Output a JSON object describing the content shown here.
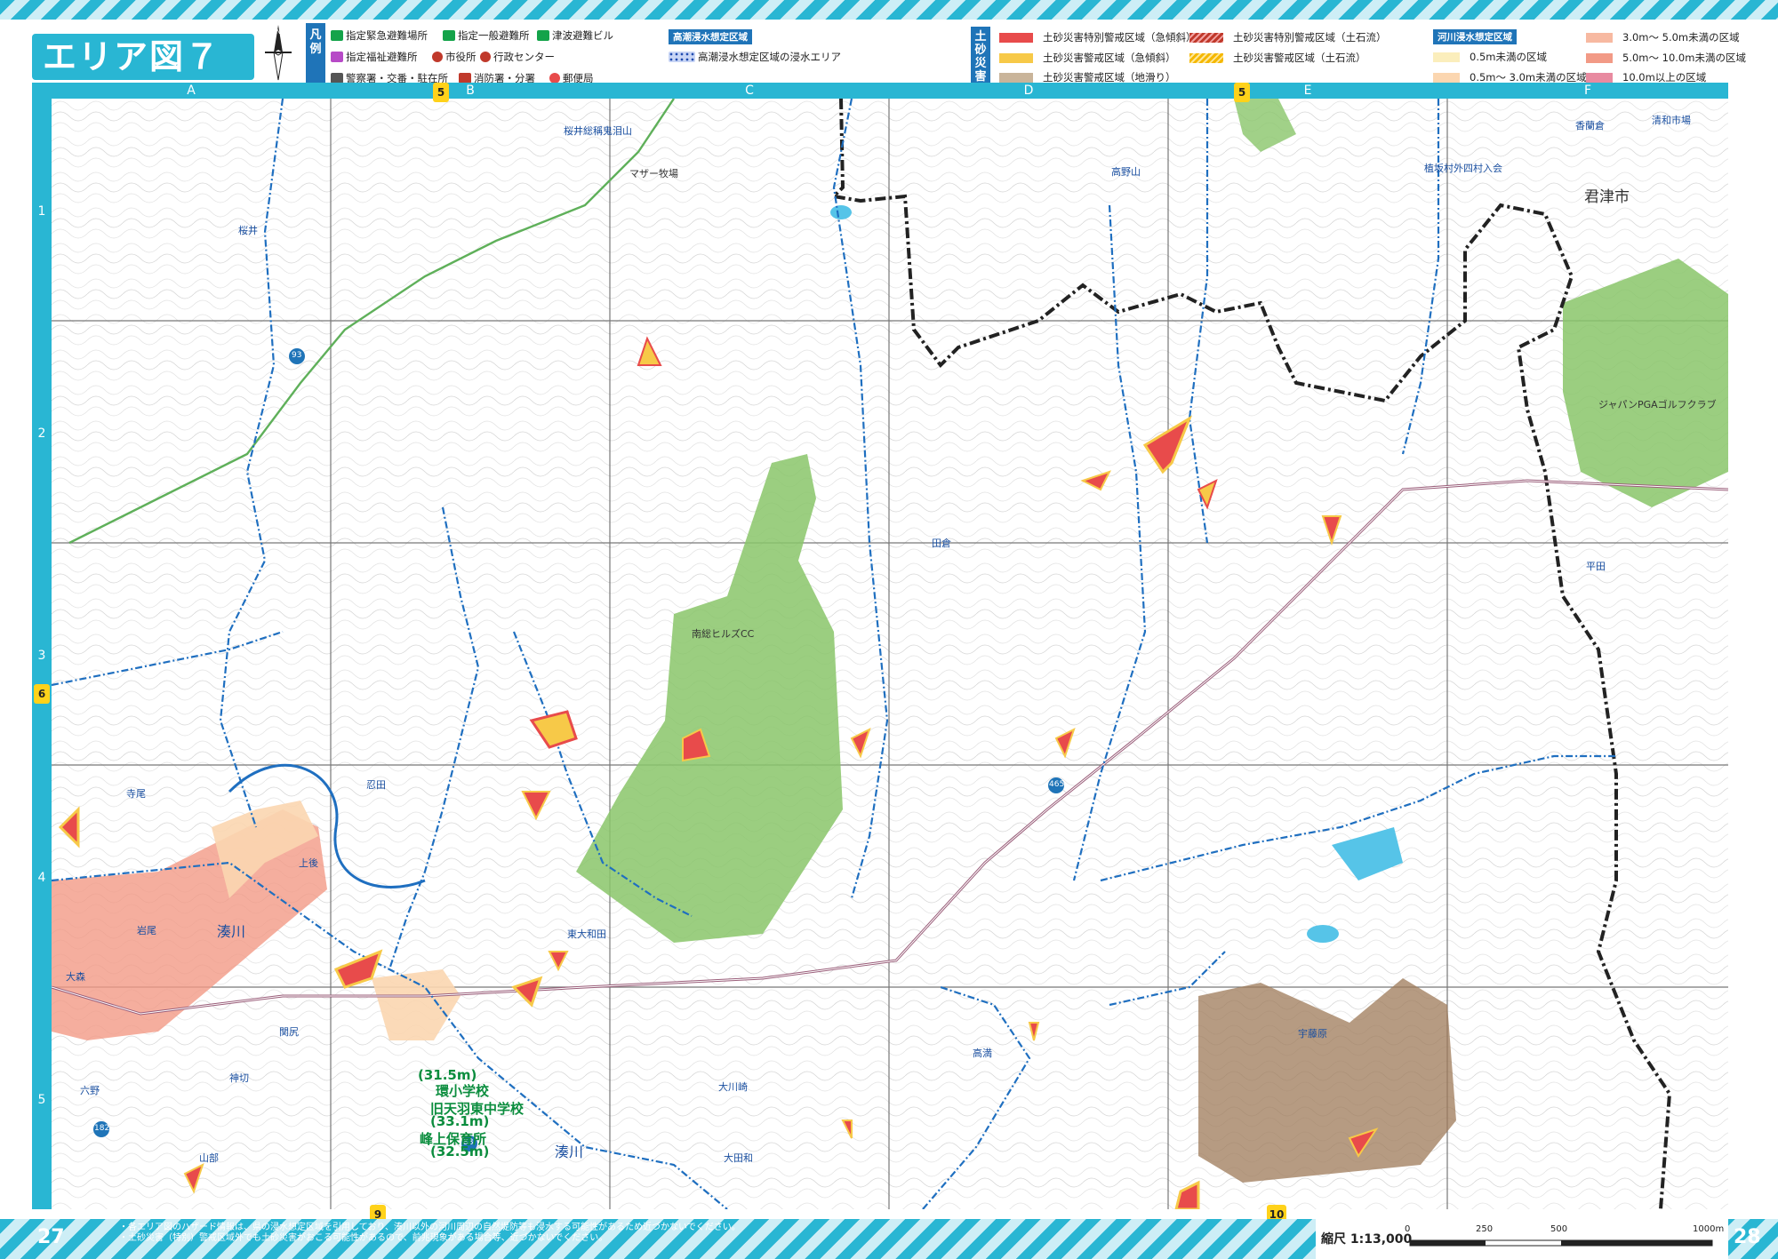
{
  "header": {
    "title": "エリア図７",
    "legend_label": "凡例",
    "legend_items": [
      {
        "label": "指定緊急避難場所",
        "icon": "emergency-shelter-icon"
      },
      {
        "label": "指定一般避難所",
        "icon": "general-shelter-icon"
      },
      {
        "label": "津波避難ビル",
        "icon": "tsunami-building-icon"
      },
      {
        "label": "指定福祉避難所",
        "icon": "welfare-shelter-icon"
      },
      {
        "label": "市役所",
        "icon": "city-hall-icon"
      },
      {
        "label": "行政センター",
        "icon": "admin-center-icon"
      },
      {
        "label": "警察署・交番・駐在所",
        "icon": "police-icon"
      },
      {
        "label": "消防署・分署",
        "icon": "fire-station-icon"
      },
      {
        "label": "郵便局",
        "icon": "post-office-icon"
      }
    ],
    "storm_surge": {
      "heading": "高潮浸水想定区域",
      "item": "高潮浸水想定区域の浸水エリア"
    },
    "sediment": {
      "heading": "土砂災害",
      "items": [
        {
          "label": "土砂災害特別警戒区域（急傾斜）",
          "color": "#e84b4b"
        },
        {
          "label": "土砂災害特別警戒区域（土石流）",
          "color": "#c0392b"
        },
        {
          "label": "土砂災害警戒区域（急傾斜）",
          "color": "#f7c948"
        },
        {
          "label": "土砂災害警戒区域（土石流）",
          "color": "#f5b800"
        },
        {
          "label": "土砂災害警戒区域（地滑り）",
          "color": "#c9b49a"
        }
      ]
    },
    "river_flood": {
      "heading": "河川浸水想定区域",
      "items": [
        {
          "label": "0.5m未満の区域",
          "color": "#fbeebc"
        },
        {
          "label": "0.5m～ 3.0m未満の区域",
          "color": "#fbd6b0"
        },
        {
          "label": "3.0m～ 5.0m未満の区域",
          "color": "#f7b9a1"
        },
        {
          "label": "5.0m～ 10.0m未満の区域",
          "color": "#f29a86"
        },
        {
          "label": "10.0m以上の区域",
          "color": "#e88aa0"
        }
      ]
    }
  },
  "grid": {
    "columns": [
      "A",
      "B",
      "C",
      "D",
      "E",
      "F"
    ],
    "rows": [
      "1",
      "2",
      "3",
      "4",
      "5"
    ]
  },
  "markers": {
    "top_b": "5",
    "top_e": "5",
    "left": "6",
    "bottom_b": "9",
    "bottom_e": "10"
  },
  "labels": {
    "sakurai_kanonji": "桜井総稱鬼泪山",
    "mother_farm": "マザー牧場",
    "takanoyama": "高野山",
    "kazusa": "君津市",
    "gengo": "香蘭倉",
    "seiwa": "清和市場",
    "nishi_shiro": "植坂村外四村入会",
    "sakurai": "桜井",
    "japan_pga": "ジャパンPGAゴルフクラブ",
    "nanso_hills": "南総ヒルズCC",
    "tagura": "田倉",
    "hirata": "平田",
    "shimoda": "忍田",
    "teramae": "寺尾",
    "ueushiro": "上後",
    "minatogawa": "湊川",
    "yoshio": "岩尾",
    "ohmori": "大森",
    "higashi_owada": "東大和田",
    "owada": "大田和",
    "okawasaki": "大川崎",
    "takamitsu": "高満",
    "ukata": "宇藤原",
    "sekijiri": "関尻",
    "rokuno": "六野",
    "kanbuchi": "神切",
    "yamanobe": "山部",
    "minatogawa2": "湊川",
    "route93": "93",
    "route465": "465",
    "route182": "182",
    "route88": "88"
  },
  "facilities": [
    {
      "elev": "(31.5m)",
      "name": "環小学校"
    },
    {
      "elev": "",
      "name": "旧天羽東中学校"
    },
    {
      "elev": "(33.1m)",
      "name": ""
    },
    {
      "elev": "",
      "name": "峰上保育所"
    },
    {
      "elev": "(32.5m)",
      "name": ""
    }
  ],
  "footer": {
    "page_left": "27",
    "page_right": "28",
    "note1": "・各エリア図のハザード情報は、県の浸水想定区域を引用しており、湊川以外の河川周辺の自然堤防等も浸水する可能性があるため近づかないでください。",
    "note2": "・土砂災害（特別）警戒区域外でも土砂災害がおこる可能性があるので、前兆現象がある場合等、近づかないでください。",
    "scale": "縮尺 1:13,000",
    "scale_ticks": [
      "0",
      "250",
      "500",
      "1000m"
    ]
  }
}
